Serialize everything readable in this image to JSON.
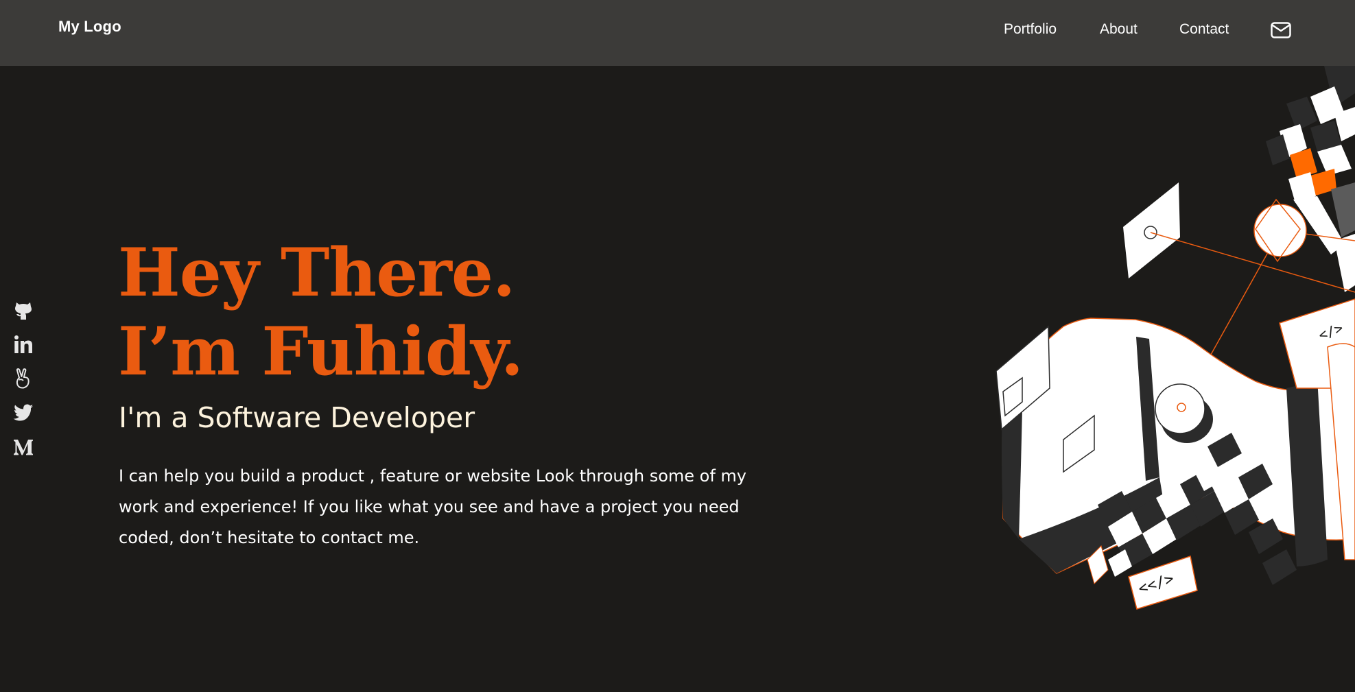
{
  "header": {
    "logo": "My Logo",
    "nav": [
      {
        "label": "Portfolio"
      },
      {
        "label": "About"
      },
      {
        "label": "Contact"
      }
    ],
    "mail_icon": "mail-icon"
  },
  "social": [
    {
      "icon": "github-icon"
    },
    {
      "icon": "linkedin-icon"
    },
    {
      "icon": "angellist-icon"
    },
    {
      "icon": "twitter-icon"
    },
    {
      "icon": "medium-icon"
    }
  ],
  "hero": {
    "title_line1": "Hey There.",
    "title_line2": "I’m Fuhidy.",
    "subtitle": "I'm a Software Developer",
    "description": "I can help you build a product , feature or website Look through some of my work and experience! If you like what you see and have a project you need coded, don’t hesitate to contact me."
  },
  "illustration": {
    "code_tag_1": "<</>",
    "code_tag_2": "</>"
  },
  "colors": {
    "accent": "#ea5b10",
    "background": "#1c1b19",
    "navbar": "#3c3b39",
    "subtitle": "#fdf3dd"
  }
}
